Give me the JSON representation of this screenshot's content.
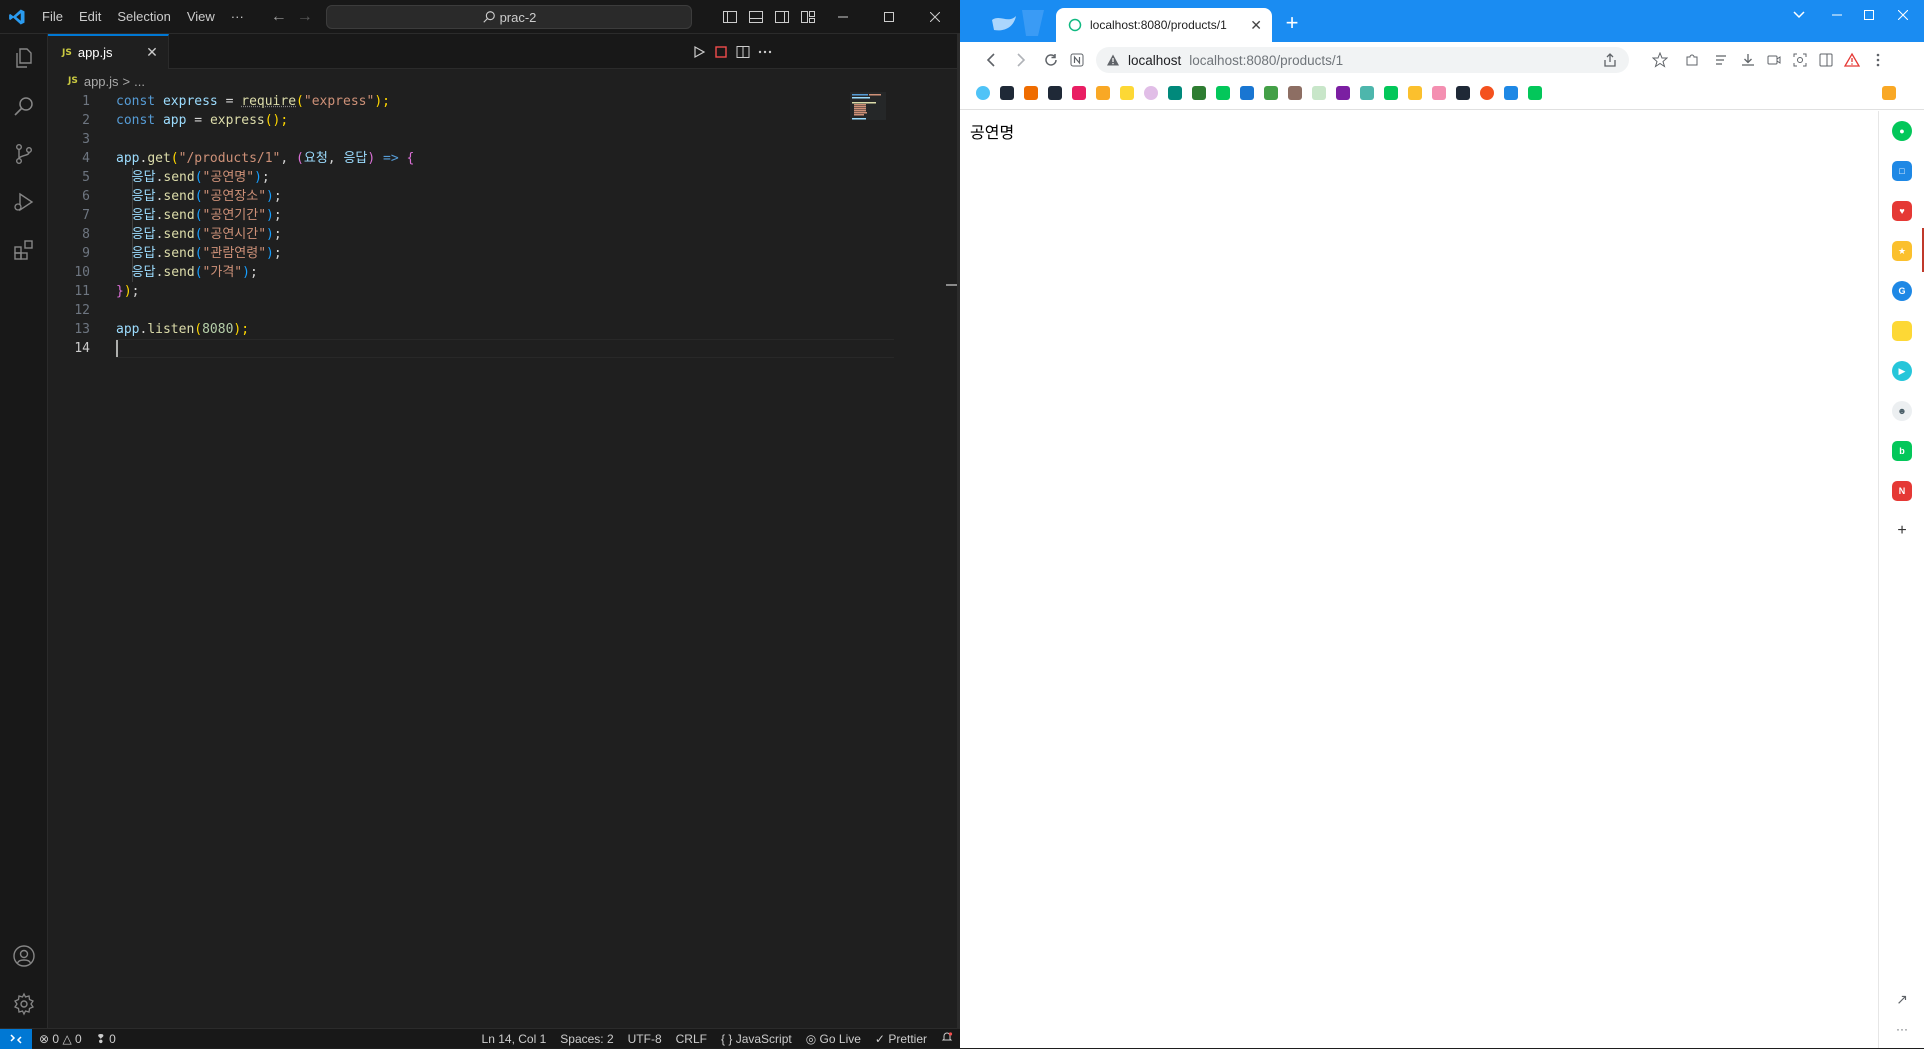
{
  "vscode": {
    "menu": [
      "File",
      "Edit",
      "Selection",
      "View",
      "···"
    ],
    "search_text": "prac-2",
    "tab": {
      "badge": "JS",
      "label": "app.js",
      "close": "✕"
    },
    "breadcrumb": {
      "badge": "JS",
      "file": "app.js",
      "sep": ">",
      "rest": "..."
    },
    "line_numbers": [
      "1",
      "2",
      "3",
      "4",
      "5",
      "6",
      "7",
      "8",
      "9",
      "10",
      "11",
      "12",
      "13",
      "14"
    ],
    "code": {
      "l1": {
        "a": "const",
        "b": " ",
        "c": "express",
        "d": " = ",
        "e": "require",
        "f": "(",
        "g": "\"express\"",
        "h": ");"
      },
      "l2": {
        "a": "const",
        "b": " ",
        "c": "app",
        "d": " = ",
        "e": "express",
        "f": "();"
      },
      "l4": {
        "a": "app",
        "b": ".",
        "c": "get",
        "d": "(",
        "e": "\"/products/1\"",
        "f": ", ",
        "g": "(",
        "h": "요청",
        "i": ", ",
        "j": "응답",
        "k": ")",
        "l": " => ",
        "m": "{"
      },
      "sends": [
        {
          "obj": "응답",
          "m": "send",
          "arg": "\"공연명\""
        },
        {
          "obj": "응답",
          "m": "send",
          "arg": "\"공연장소\""
        },
        {
          "obj": "응답",
          "m": "send",
          "arg": "\"공연기간\""
        },
        {
          "obj": "응답",
          "m": "send",
          "arg": "\"공연시간\""
        },
        {
          "obj": "응답",
          "m": "send",
          "arg": "\"관람연령\""
        },
        {
          "obj": "응답",
          "m": "send",
          "arg": "\"가격\""
        }
      ],
      "l11": {
        "a": "}",
        "b": ")",
        "c": ";"
      },
      "l13": {
        "a": "app",
        "b": ".",
        "c": "listen",
        "d": "(",
        "e": "8080",
        "f": ");"
      }
    },
    "status": {
      "errors": "0",
      "warnings": "0",
      "ports": "0",
      "position": "Ln 14, Col 1",
      "spaces": "Spaces: 2",
      "encoding": "UTF-8",
      "eol": "CRLF",
      "language_icon": "{ }",
      "language": "JavaScript",
      "golive": "Go Live",
      "prettier": "Prettier"
    }
  },
  "browser": {
    "tab_title": "localhost:8080/products/1",
    "tab_close": "✕",
    "new_tab": "+",
    "omnibox": {
      "host": "localhost",
      "url": "localhost:8080/products/1"
    },
    "page_text": "공연명",
    "accent_color": "#1a8cf2"
  }
}
